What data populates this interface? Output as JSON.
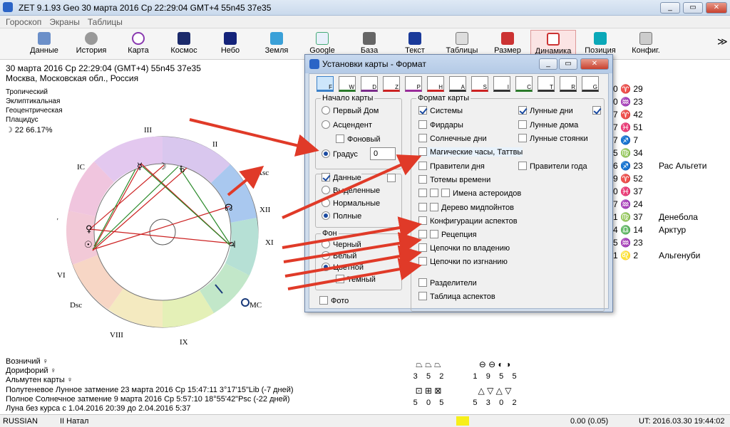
{
  "window": {
    "title": "ZET 9.1.93 Geo   30 марта 2016  Ср  22:29:04 GMT+4 55n45  37e35",
    "min": "_",
    "max": "▭",
    "close": "✕"
  },
  "menu": [
    "Гороскоп",
    "Экраны",
    "Таблицы"
  ],
  "toolbar": [
    "Данные",
    "История",
    "Карта",
    "Космос",
    "Небо",
    "Земля",
    "Google",
    "База",
    "Текст",
    "Таблицы",
    "Размер",
    "Динамика",
    "Позиция",
    "Конфиг."
  ],
  "toolbar_more": "≫",
  "header": {
    "line1": "30 марта 2016  Ср  22:29:04 (GMT+4) 55n45  37e35",
    "line2": "Москва, Московская обл., Россия"
  },
  "settings": {
    "l1": "Тропический",
    "l2": "Эклиптикальная",
    "l3": "Геоцентрическая",
    "l4": "Плацидус",
    "moon": "☽   22 66.17%"
  },
  "chart_labels": {
    "houses": [
      "III",
      "II",
      "IC",
      "Asc",
      "XII",
      "V",
      "XI",
      "VI",
      "Dsc",
      "MC",
      "VIII",
      "IX"
    ]
  },
  "right_col": [
    {
      "n": "0",
      "s": "♈",
      "d": "29",
      "star": ""
    },
    {
      "n": "0",
      "s": "♒",
      "d": "23",
      "star": ""
    },
    {
      "n": "7",
      "s": "♈",
      "d": "42",
      "star": ""
    },
    {
      "n": "7",
      "s": "♓",
      "d": "51",
      "star": ""
    },
    {
      "n": "7",
      "s": "♐",
      "d": "7",
      "star": ""
    },
    {
      "n": "5",
      "s": "♍",
      "d": "34",
      "star": ""
    },
    {
      "n": "6",
      "s": "♐",
      "d": "23",
      "star": "Рас Альгети"
    },
    {
      "n": "9",
      "s": "♈",
      "d": "52",
      "star": ""
    },
    {
      "n": "0",
      "s": "♓",
      "d": "37",
      "star": ""
    },
    {
      "n": "7",
      "s": "♒",
      "d": "24",
      "star": ""
    },
    {
      "n": "1",
      "s": "♍",
      "d": "37",
      "star": "Денебола"
    },
    {
      "n": "4",
      "s": "♎",
      "d": "14",
      "star": "Арктур"
    },
    {
      "n": "5",
      "s": "♒",
      "d": "23",
      "star": ""
    },
    {
      "n": "1",
      "s": "♌",
      "d": "2",
      "star": "Альгенуби"
    }
  ],
  "bottom": {
    "b1": "Возничий  ♀",
    "b2": "Дорифорий  ♀",
    "b3": "Альмутен карты  ♀",
    "b4": "Полутеневое Лунное затмение 23 марта 2016 Ср 15:47:11  3°17'15\"Lib (-7 дней)",
    "b5": "Полное Солнечное затмение 9 марта 2016 Ср  5:57:10 18°55'42\"Psc (-22 дней)",
    "b6": "Луна без курса с 1.04.2016 20:39 до 2.04.2016  5:37"
  },
  "aspects": {
    "g1_top": [
      "3",
      "5",
      "2"
    ],
    "g1_bot": [
      "5",
      "0",
      "5"
    ],
    "g2_top": [
      "1",
      "9",
      "5",
      "5"
    ],
    "g2_bot": [
      "5",
      "3",
      "0",
      "2"
    ]
  },
  "status": {
    "lang": "RUSSIAN",
    "mode": "II Натал",
    "val": "0.00 (0.05)",
    "ut": "UT: 2016.03.30 19:44:02"
  },
  "dialog": {
    "title": "Установки карты - Формат",
    "tabs": [
      "F",
      "W",
      "D",
      "Z",
      "P",
      "H",
      "A",
      "S",
      "I",
      "C",
      "T",
      "R",
      "G"
    ],
    "start_group": "Начало карты",
    "start_options": [
      "Первый Дом",
      "Асцендент",
      "Фоновый",
      "Градус"
    ],
    "degree_value": "0",
    "data_label": "Данные",
    "data_options": [
      "Выделенные",
      "Нормальные",
      "Полные"
    ],
    "bg_group": "Фон",
    "bg_options": [
      "Черный",
      "Белый",
      "Цветной",
      "Темный"
    ],
    "photo": "Фото",
    "format_group": "Формат карты",
    "format_left": [
      "Системы",
      "Фирдары",
      "Солнечные дни",
      "Магические часы, Таттвы",
      "Правители дня",
      "Тотемы времени",
      "Имена астероидов",
      "Дерево мидпойнтов",
      "Конфигурации аспектов",
      "Рецепция",
      "Цепочки по владению",
      "Цепочки по изгнанию",
      "Разделители",
      "Таблица аспектов"
    ],
    "format_right": [
      "Лунные дни",
      "Лунные дома",
      "Лунные стоянки",
      "Правители года"
    ]
  }
}
